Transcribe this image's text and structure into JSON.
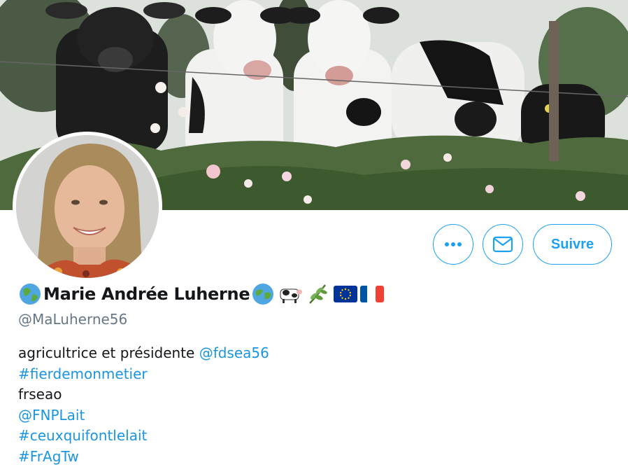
{
  "profile": {
    "display_name": "Marie Andrée Luherne",
    "handle": "@MaLuherne56",
    "bio": {
      "line1_text": "agricultrice et présidente ",
      "line1_mention": "@fdsea56",
      "line2": "#fierdemonmetier",
      "line3": "frseao",
      "line4": "@FNPLait",
      "line5": "#ceuxquifontlelait",
      "line6": "#FrAgTw"
    }
  },
  "actions": {
    "more_icon": "more-horizontal-icon",
    "message_icon": "envelope-icon",
    "follow_label": "Suivre"
  },
  "name_emojis": [
    "globe-icon",
    "globe-icon",
    "cow-icon",
    "herb-icon",
    "eu-flag-icon",
    "france-flag-icon"
  ],
  "colors": {
    "accent": "#1da1f2",
    "link": "#1b95e0",
    "handle": "#657786",
    "text": "#14171a"
  }
}
